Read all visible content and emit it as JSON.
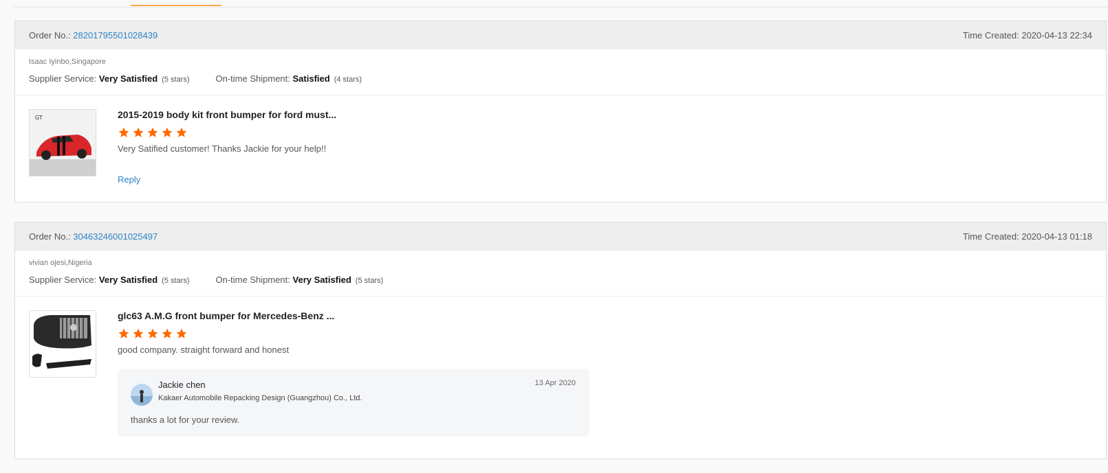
{
  "reviews": [
    {
      "order_label": "Order No.: ",
      "order_no": "28201795501028439",
      "time_created": "Time Created: 2020-04-13 22:34",
      "buyer": "Isaac Iyinbo,Singapore",
      "supplier_label": "Supplier Service: ",
      "supplier_value": "Very Satisfied",
      "supplier_stars": "(5 stars)",
      "shipment_label": "On-time Shipment: ",
      "shipment_value": "Satisfied",
      "shipment_stars": "(4 stars)",
      "product_title": "2015-2019 body kit front bumper for ford must...",
      "rating": 5,
      "comment": "Very Satified customer! Thanks Jackie for your help!!",
      "reply_link": "Reply",
      "thumb_icon": "red-car-image"
    },
    {
      "order_label": "Order No.: ",
      "order_no": "30463246001025497",
      "time_created": "Time Created: 2020-04-13 01:18",
      "buyer": "vivian ojesi,Nigeria",
      "supplier_label": "Supplier Service: ",
      "supplier_value": "Very Satisfied",
      "supplier_stars": "(5 stars)",
      "shipment_label": "On-time Shipment: ",
      "shipment_value": "Very Satisfied",
      "shipment_stars": "(5 stars)",
      "product_title": "glc63 A.M.G front bumper for Mercedes-Benz ...",
      "rating": 5,
      "comment": "good company. straight forward and honest",
      "thumb_icon": "bumper-parts-image",
      "seller_reply": {
        "name": "Jackie chen",
        "company": "Kakaer Automobile Repacking Design (Guangzhou) Co., Ltd.",
        "date": "13 Apr 2020",
        "text": "thanks a lot for your review."
      }
    }
  ],
  "colors": {
    "link": "#2b83c6",
    "star": "#ff6a00",
    "tab_accent": "#f7a84a"
  }
}
